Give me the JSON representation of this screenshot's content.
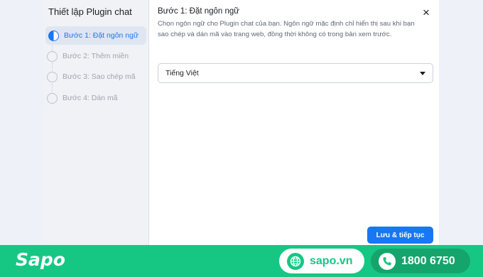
{
  "sidebar": {
    "title": "Thiết lập Plugin chat",
    "steps": [
      {
        "label": "Bước 1: Đặt ngôn ngữ",
        "state": "active"
      },
      {
        "label": "Bước 2: Thêm miền",
        "state": "pending"
      },
      {
        "label": "Bước 3: Sao chép mã",
        "state": "pending"
      },
      {
        "label": "Bước 4: Dán mã",
        "state": "pending"
      }
    ]
  },
  "content": {
    "heading": "Bước 1: Đặt ngôn ngữ",
    "description": "Chọn ngôn ngữ cho Plugin chat của bạn. Ngôn ngữ mặc định chỉ hiển thị sau khi bạn sao chép và dán mã vào trang web, đồng thời không có trong bản xem trước.",
    "language_select": {
      "value": "Tiếng Việt"
    },
    "primary_button": "Lưu & tiếp tục",
    "close_icon": "×"
  },
  "footer": {
    "logo_text": "Sapo",
    "website": "sapo.vn",
    "phone": "1800 6750"
  },
  "colors": {
    "accent": "#1877f2",
    "brand_green": "#16c784",
    "phone_pill": "#15a56c"
  },
  "icons": [
    "globe-icon",
    "phone-icon",
    "close-icon",
    "chevron-down-icon",
    "step-progress-icon"
  ]
}
